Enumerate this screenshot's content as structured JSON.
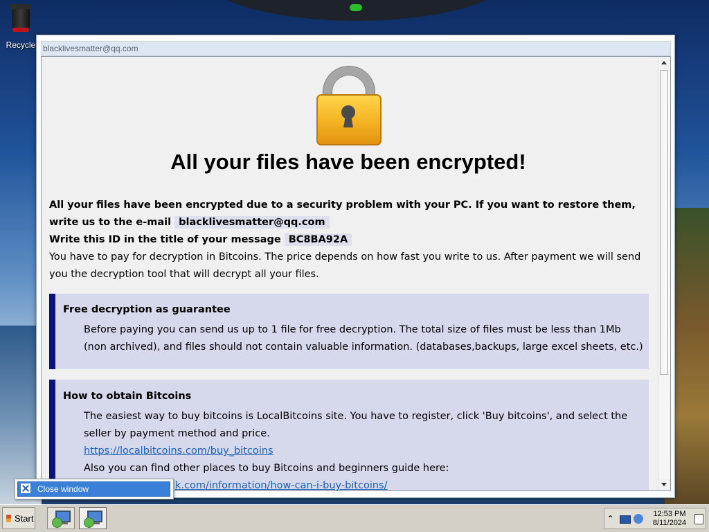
{
  "desktop": {
    "recycle_bin_label": "Recycle"
  },
  "window": {
    "title": "blacklivesmatter@qq.com",
    "lock_icon": "padlock-icon",
    "headline": "All your files have been encrypted!",
    "intro_text": "All your files have been encrypted due to a security problem with your PC. If you want to restore them, write us to the e-mail",
    "email": "blacklivesmatter@qq.com",
    "id_text": "Write this ID in the title of your message",
    "id_value": "BC8BA92A",
    "payment_text": "You have to pay for decryption in Bitcoins. The price depends on how fast you write to us. After payment we will send you the decryption tool that will decrypt all your files.",
    "free_section": {
      "heading": "Free decryption as guarantee",
      "body": "Before paying you can send us up to 1 file for free decryption. The total size of files must be less than 1Mb (non archived), and files should not contain valuable information. (databases,backups, large excel sheets, etc.)"
    },
    "bitcoin_section": {
      "heading": "How to obtain Bitcoins",
      "body": "The easiest way to buy bitcoins is LocalBitcoins site. You have to register, click 'Buy bitcoins', and select the seller by payment method and price.",
      "link1": "https://localbitcoins.com/buy_bitcoins",
      "also_text": "Also you can find other places to buy Bitcoins and beginners guide here:",
      "link2_visible": "k.com/information/how-can-i-buy-bitcoins/"
    }
  },
  "tooltip": {
    "label": "Close window",
    "icon": "close-icon"
  },
  "taskbar": {
    "start_label": "Start",
    "clock_time": "12:53 PM",
    "clock_date": "8/11/2024"
  },
  "colors": {
    "guide_box_bg": "#d6d8ec",
    "guide_box_accent": "#0c1280",
    "link": "#1a5fb4",
    "highlight": "#dfe0ee"
  }
}
